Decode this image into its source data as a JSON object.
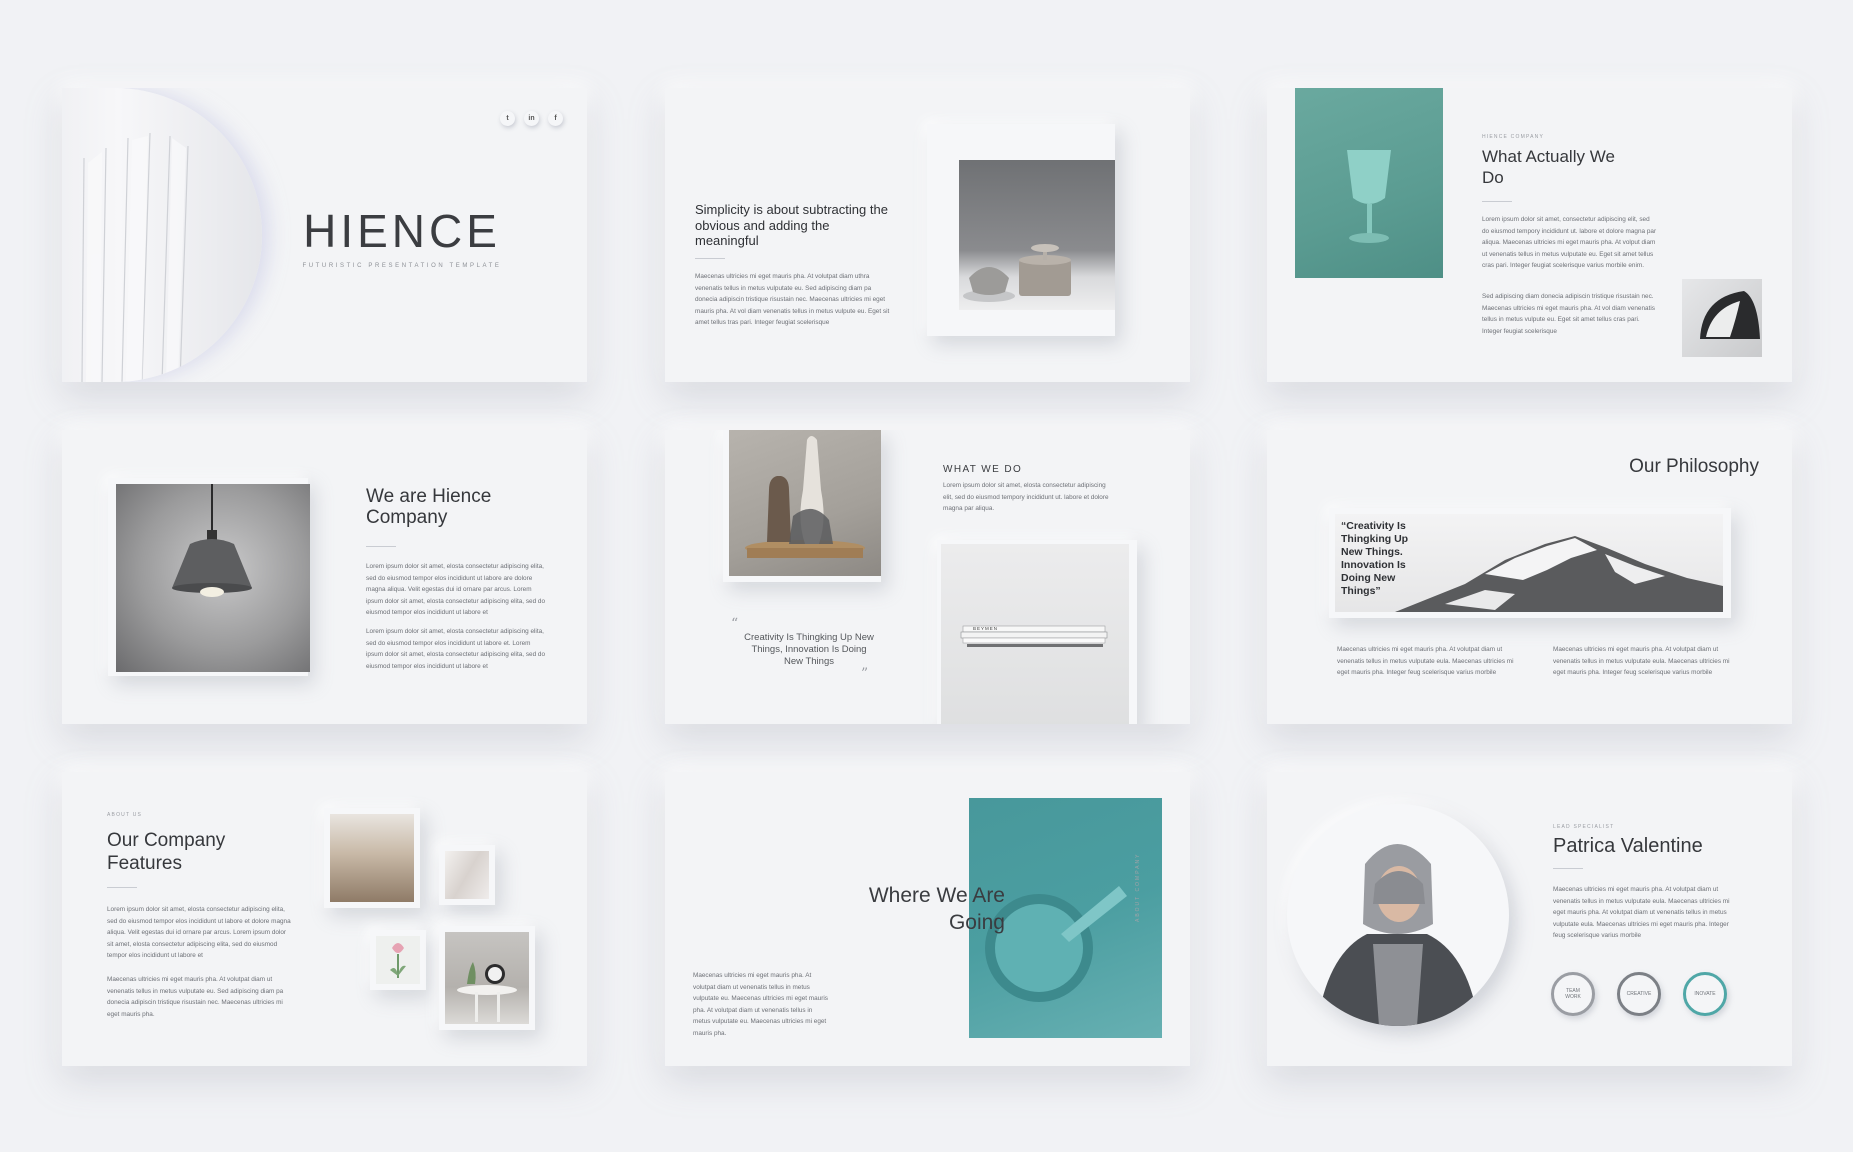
{
  "slide1": {
    "title": "HIENCE",
    "subtitle": "FUTURISTIC PRESENTATION TEMPLATE",
    "social": [
      "t",
      "in",
      "f"
    ]
  },
  "slide2": {
    "heading": "Simplicity is about subtracting the obvious and adding the meaningful",
    "body": "Maecenas ultricies mi eget mauris pha. At volutpat diam uthra venenatis tellus in metus vulputate eu. Sed adipiscing diam pa donecia adipiscin tristique risustain nec. Maecenas ultricies mi eget mauris pha. At vol diam venenatis tellus in metus vulpute eu. Eget sit amet tellus tras pari. Integer feugiat scelerisque"
  },
  "slide3": {
    "eyebrow": "HIENCE COMPANY",
    "title": "What Actually We Do",
    "body1": "Lorem ipsum dolor sit amet, consectetur adipiscing elit, sed do eiusmod tempory incididunt ut. labore et dolore magna par aliqua. Maecenas ultricies mi eget mauris pha. At volput diam ut venenatis tellus in metus vulputate eu. Eget sit amet tellus cras pari. Integer feugiat scelerisque varius morbile enim.",
    "body2": "Sed adipiscing diam donecia adipiscin tristique risustain nec. Maecenas ultricies mi eget mauris pha. At vol diam venenatis tellus in metus vulpute eu. Eget sit amet tellus cras pari. Integer feugiat scelerisque"
  },
  "slide4": {
    "title": "We are Hience Company",
    "body1": "Lorem ipsum dolor sit amet, elosta consectetur adipiscing elita, sed do eiusmod tempor elos incididunt ut labore are dolore magna aliqua. Velit egestas dui id ornare par arcus. Lorem ipsum dolor sit amet, elosta consectetur adipiscing elita, sed do eiusmod tempor elos incididunt ut labore et",
    "body2": "Lorem ipsum dolor sit amet, elosta consectetur adipiscing elita, sed do eiusmod tempor elos incididunt ut labore et. Lorem ipsum dolor sit amet, elosta consectetur adipiscing elita, sed do eiusmod tempor elos incididunt ut labore et"
  },
  "slide5": {
    "title": "WHAT WE DO",
    "body": "Lorem ipsum dolor sit amet, elosta consectetur adipiscing elit, sed do eiusmod tempory incididunt ut. labore et dolore magna par aliqua.",
    "quote": "Creativity Is Thingking Up New Things, Innovation Is Doing New Things",
    "book_label": "BEYMEN"
  },
  "slide6": {
    "title": "Our Philosophy",
    "quote": "“Creativity Is Thingking Up New Things. Innovation Is Doing New Things”",
    "col1": "Maecenas ultricies mi eget mauris pha. At volutpat diam ut venenatis tellus in metus vulputate eula. Maecenas ultricies mi eget mauris pha. Integer feug scelerisque varius morbile",
    "col2": "Maecenas ultricies mi eget mauris pha. At volutpat diam ut venenatis tellus in metus vulputate eula. Maecenas ultricies mi eget mauris pha. Integer feug scelerisque varius morbile"
  },
  "slide7": {
    "eyebrow": "ABOUT US",
    "title": "Our Company Features",
    "body1": "Lorem ipsum dolor sit amet, elosta consectetur adipiscing elita, sed do eiusmod tempor elos incididunt ut labore et dolore magna aliqua. Velit egestas dui id ornare par arcus. Lorem ipsum dolor sit amet, elosta consectetur adipiscing elita, sed do eiusmod tempor elos incididunt ut labore et",
    "body2": "Maecenas ultricies mi eget mauris pha. At volutpat diam ut venenatis tellus in metus vulputate eu. Sed adipiscing diam pa donecia adipiscin tristique risustain nec. Maecenas ultricies mi eget mauris pha."
  },
  "slide8": {
    "title": "Where We Are Going",
    "vertical": "ABOUT COMPANY",
    "body": "Maecenas ultricies mi eget mauris pha. At volutpat diam ut venenatis tellus in metus vulputate eu. Maecenas ultricies mi eget mauris pha. At volutpat diam ut venenatis tellus in metus vulputate eu. Maecenas ultricies mi eget mauris pha."
  },
  "slide9": {
    "eyebrow": "LEAD SPECIALIST",
    "name": "Patrica Valentine",
    "body": "Maecenas ultricies mi eget mauris pha. At volutpat diam ut venenatis tellus in metus vulputate eula. Maecenas ultricies mi eget mauris pha. At volutpat diam ut venenatis tellus in metus vulputate eula. Maecenas ultricies mi eget mauris pha. Integer feug scelerisque varius morbile",
    "rings": [
      {
        "label": "TEAM WORK",
        "color": "#9a9da3"
      },
      {
        "label": "CREATIVE",
        "color": "#7c8086"
      },
      {
        "label": "INOVATE",
        "color": "#4fa7a7"
      }
    ]
  },
  "colors": {
    "teal": "#5f9f97",
    "teal_dark": "#3f8d8f",
    "background": "#f1f2f5"
  }
}
